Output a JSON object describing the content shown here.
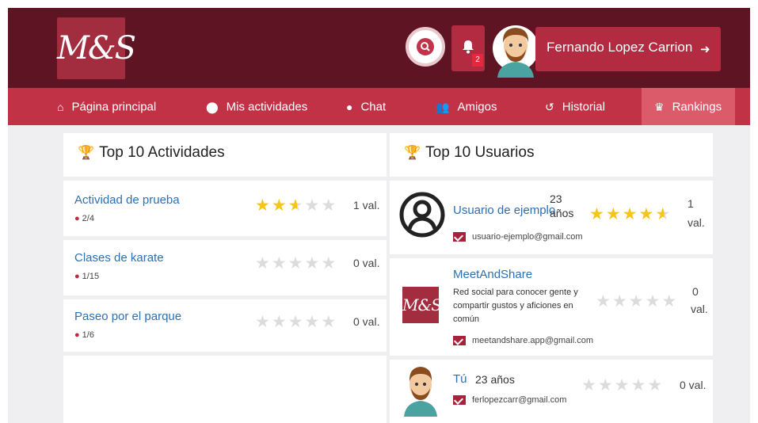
{
  "header": {
    "logo": "M&S",
    "notifications_count": "2",
    "user_name": "Fernando Lopez Carrion",
    "icons": {
      "search": "search-icon",
      "bell": "bell-icon",
      "logout": "logout-icon"
    }
  },
  "nav": {
    "items": [
      {
        "label": "Página principal",
        "icon": "home-icon"
      },
      {
        "label": "Mis actividades",
        "icon": "map-marker-icon"
      },
      {
        "label": "Chat",
        "icon": "chat-bubble-icon"
      },
      {
        "label": "Amigos",
        "icon": "users-icon"
      },
      {
        "label": "Historial",
        "icon": "history-icon"
      },
      {
        "label": "Rankings",
        "icon": "crown-icon",
        "active": true
      }
    ]
  },
  "activities_panel": {
    "title": "Top 10 Actividades",
    "rows": [
      {
        "name": "Actividad de prueba",
        "participants": "2/4",
        "rating": 2.5,
        "ratings_text": "1 val."
      },
      {
        "name": "Clases de karate",
        "participants": "1/15",
        "rating": 0,
        "ratings_text": "0 val."
      },
      {
        "name": "Paseo por el parque",
        "participants": "1/6",
        "rating": 0,
        "ratings_text": "0 val."
      }
    ]
  },
  "users_panel": {
    "title": "Top 10 Usuarios",
    "rows": [
      {
        "name": "Usuario de ejemplo",
        "age_num": "23",
        "age_unit": "años",
        "email": "usuario-ejemplo@gmail.com",
        "rating": 4.5,
        "ratings_num": "1",
        "ratings_unit": "val."
      },
      {
        "name": "MeetAndShare",
        "description": "Red social para conocer gente y compartir gustos y aficiones en común",
        "email": "meetandshare.app@gmail.com",
        "rating": 0,
        "ratings_num": "0",
        "ratings_unit": "val."
      },
      {
        "name": "Tú",
        "age": "23 años",
        "email": "ferlopezcarr@gmail.com",
        "rating": 0,
        "ratings_text": "0 val."
      }
    ]
  },
  "colors": {
    "header_dark": "#5e1423",
    "nav": "#c23246",
    "nav_active": "#dc5b6a",
    "accent": "#b22b41",
    "link": "#2d6fb3",
    "star": "#f5c518"
  }
}
